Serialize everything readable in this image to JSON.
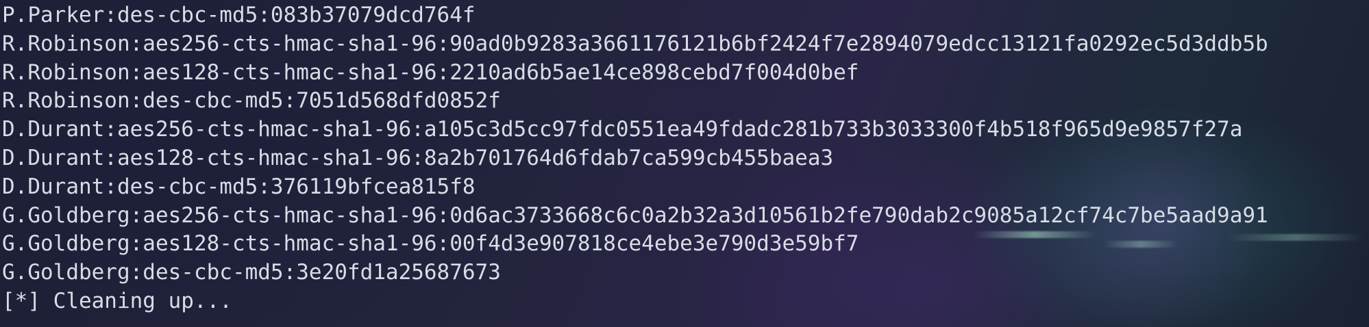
{
  "terminal": {
    "lines": [
      "P.Parker:des-cbc-md5:083b37079dcd764f",
      "R.Robinson:aes256-cts-hmac-sha1-96:90ad0b9283a3661176121b6bf2424f7e2894079edcc13121fa0292ec5d3ddb5b",
      "R.Robinson:aes128-cts-hmac-sha1-96:2210ad6b5ae14ce898cebd7f004d0bef",
      "R.Robinson:des-cbc-md5:7051d568dfd0852f",
      "D.Durant:aes256-cts-hmac-sha1-96:a105c3d5cc97fdc0551ea49fdadc281b733b3033300f4b518f965d9e9857f27a",
      "D.Durant:aes128-cts-hmac-sha1-96:8a2b701764d6fdab7ca599cb455baea3",
      "D.Durant:des-cbc-md5:376119bfcea815f8",
      "G.Goldberg:aes256-cts-hmac-sha1-96:0d6ac3733668c6c0a2b32a3d10561b2fe790dab2c9085a12cf74c7be5aad9a91",
      "G.Goldberg:aes128-cts-hmac-sha1-96:00f4d3e907818ce4ebe3e790d3e59bf7",
      "G.Goldberg:des-cbc-md5:3e20fd1a25687673",
      "[*] Cleaning up..."
    ]
  },
  "colors": {
    "background": "#1c1d33",
    "text": "#d8dde6"
  }
}
